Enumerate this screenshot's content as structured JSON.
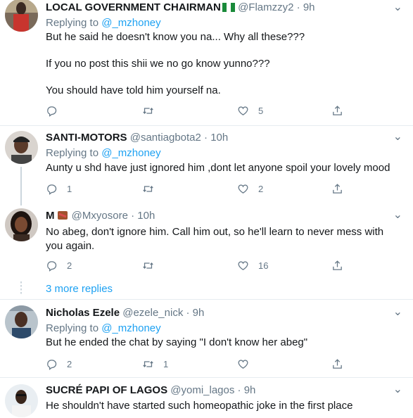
{
  "tweets": [
    {
      "name": "LOCAL GOVERNMENT CHAIRMAN",
      "handle": "@Flamzzy2",
      "time": "9h",
      "replying_label": "Replying to",
      "replying_to": "@_mzhoney",
      "lines": [
        "But he said he doesn't know you na... Why all these???",
        "If you no post this shii we no go know yunno???",
        "You should have told him yourself na."
      ],
      "replies": "",
      "retweets": "",
      "likes": "5"
    },
    {
      "name": "SANTI-MOTORS",
      "handle": "@santiagbota2",
      "time": "10h",
      "replying_label": "Replying to",
      "replying_to": "@_mzhoney",
      "text": "Aunty u shd have just ignored him ,dont let anyone spoil your lovely mood",
      "replies": "1",
      "retweets": "",
      "likes": "2"
    },
    {
      "name": "M",
      "handle": "@Mxyosore",
      "time": "10h",
      "text": "No abeg, don't ignore him. Call him out, so he'll learn to never mess with you again.",
      "replies": "2",
      "retweets": "",
      "likes": "16"
    },
    {
      "name": "Nicholas Ezele",
      "handle": "@ezele_nick",
      "time": "9h",
      "replying_label": "Replying to",
      "replying_to": "@_mzhoney",
      "text": "But he ended the chat by saying \"I don't know her abeg\"",
      "replies": "2",
      "retweets": "1",
      "likes": ""
    },
    {
      "name": "SUCRÉ PAPI OF LAGOS",
      "handle": "@yomi_lagos",
      "time": "9h",
      "text": "He shouldn't have started such homeopathic joke in the first place"
    }
  ],
  "more_replies": "3 more replies",
  "dot": "·",
  "colors": {
    "accent": "#1da1f2",
    "secondary": "#657786",
    "divider": "#e6ecf0"
  },
  "icons": [
    "reply-icon",
    "retweet-icon",
    "like-icon",
    "share-icon",
    "more-icon",
    "nigeria-flag-icon",
    "lips-icon"
  ]
}
